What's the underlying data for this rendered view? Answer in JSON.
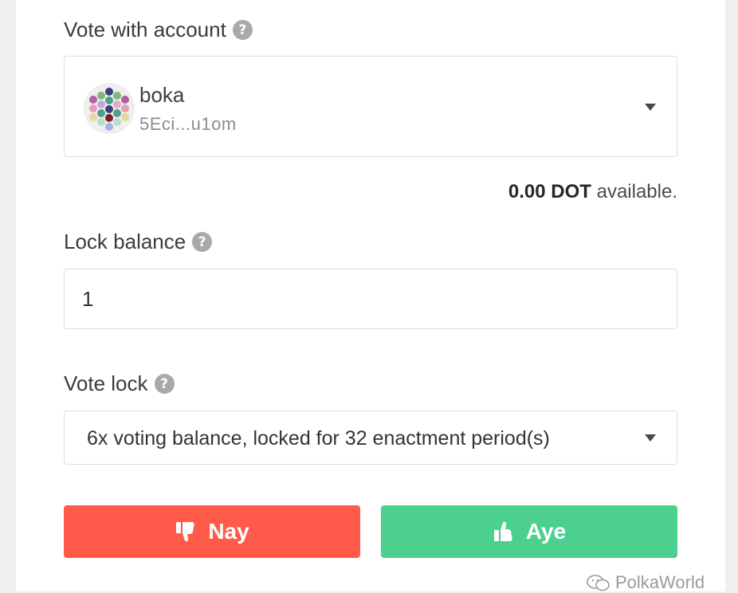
{
  "vote_account": {
    "label": "Vote with account",
    "help_icon": "question-circle-icon",
    "account_name": "boka",
    "account_address": "5Eci...u1om",
    "avatar_icon": "identicon"
  },
  "availability": {
    "amount": "0.00 DOT",
    "suffix": " available."
  },
  "lock_balance": {
    "label": "Lock balance",
    "help_icon": "question-circle-icon",
    "value": "1"
  },
  "vote_lock": {
    "label": "Vote lock",
    "help_icon": "question-circle-icon",
    "selected": "6x voting balance, locked for 32 enactment period(s)"
  },
  "buttons": {
    "nay_label": "Nay",
    "nay_icon": "thumbs-down-icon",
    "nay_color": "#ff5a4a",
    "aye_label": "Aye",
    "aye_icon": "thumbs-up-icon",
    "aye_color": "#4cd08f"
  },
  "watermark": {
    "text": "PolkaWorld"
  }
}
